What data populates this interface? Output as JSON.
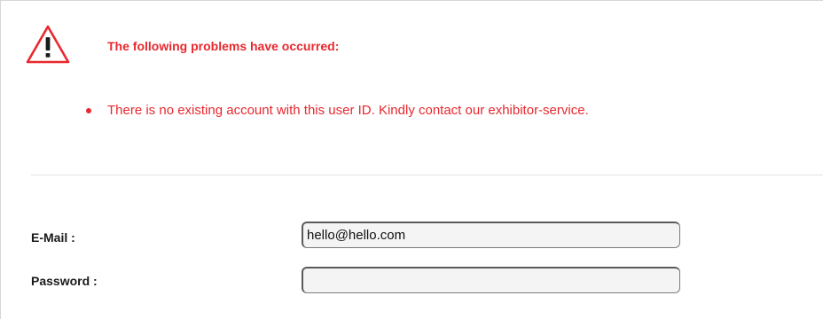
{
  "errors": {
    "heading": "The following problems have occurred:",
    "icon": "warning-triangle-icon",
    "items": [
      "There is no existing account with this user ID. Kindly contact our exhibitor-service."
    ],
    "color": "#e8282e"
  },
  "login_form": {
    "email": {
      "label": "E-Mail :",
      "value": "hello@hello.com"
    },
    "password": {
      "label": "Password :",
      "value": ""
    }
  }
}
